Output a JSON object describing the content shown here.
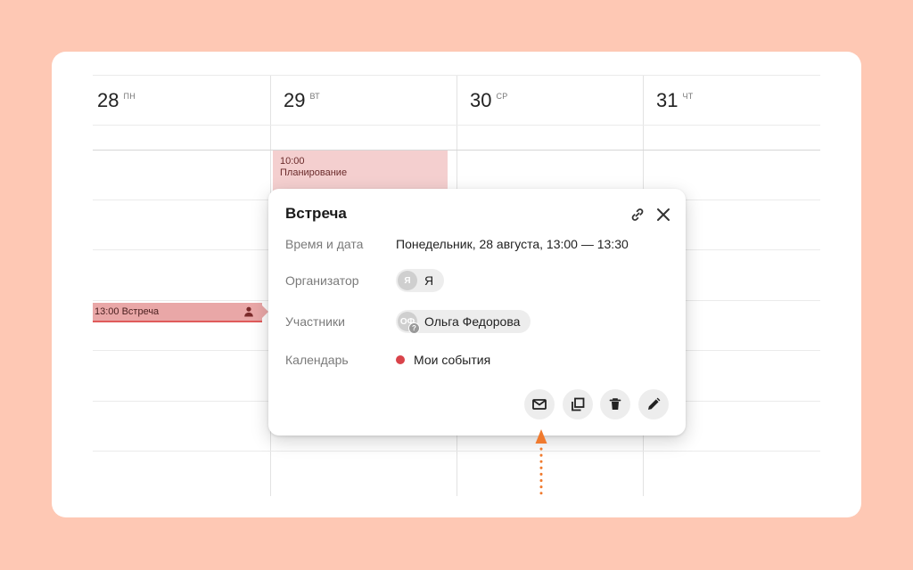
{
  "calendar": {
    "days": [
      {
        "num": "28",
        "name": "ПН"
      },
      {
        "num": "29",
        "name": "ВТ"
      },
      {
        "num": "30",
        "name": "СР"
      },
      {
        "num": "31",
        "name": "ЧТ"
      }
    ],
    "events": {
      "planning": {
        "time": "10:00",
        "title": "Планирование"
      },
      "meeting": {
        "label": "13:00 Встреча"
      }
    }
  },
  "popup": {
    "title": "Встреча",
    "rows": {
      "datetime": {
        "label": "Время и дата",
        "value": "Понедельник, 28 августа, 13:00 — 13:30"
      },
      "organizer": {
        "label": "Организатор",
        "initial": "Я",
        "name": "Я"
      },
      "participants": {
        "label": "Участники",
        "initials": "ОФ",
        "badge": "?",
        "name": "Ольга Федорова"
      },
      "calendar": {
        "label": "Календарь",
        "value": "Мои события",
        "color": "#d9434a"
      }
    },
    "actions": [
      "mail-icon",
      "copy-icon",
      "trash-icon",
      "edit-icon"
    ]
  },
  "colors": {
    "background": "#fec8b4",
    "event_light": "#f4cfcf",
    "event_selected": "#e9a7a7",
    "accent_line": "#e05b5b",
    "arrow": "#f07a2e"
  }
}
